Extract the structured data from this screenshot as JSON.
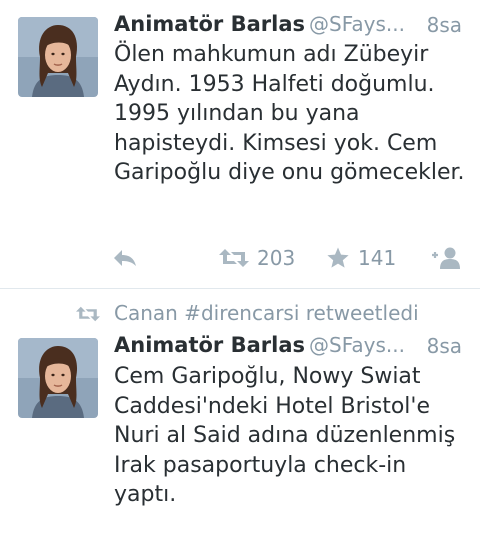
{
  "tweets": [
    {
      "author_name": "Animatör Barlas",
      "handle": "@SFays...",
      "time": "8sa",
      "text": "Ölen mahkumun adı Zübeyir Aydın. 1953 Halfeti doğumlu. 1995 yılından bu yana hapisteydi. Kimsesi yok. Cem Garipoğlu diye onu gömecekler.",
      "retweet_count": "203",
      "favorite_count": "141",
      "avatar_icon": "profile-photo"
    },
    {
      "context": "Canan #direncarsi retweetledi",
      "author_name": "Animatör Barlas",
      "handle": "@SFays...",
      "time": "8sa",
      "text": "Cem Garipoğlu, Nowy Swiat Caddesi'ndeki Hotel Bristol'e Nuri al Said adına düzenlenmiş Irak pasaportuyla check-in yaptı.",
      "avatar_icon": "profile-photo"
    }
  ],
  "colors": {
    "text": "#292f33",
    "secondary": "#8899a6",
    "icon": "#aab8c2",
    "divider": "#e1e8ed"
  }
}
